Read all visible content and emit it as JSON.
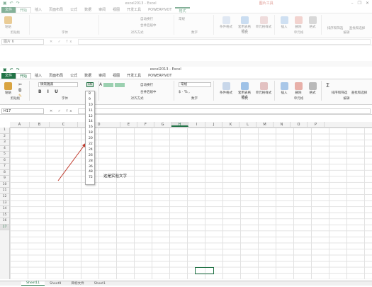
{
  "back_window": {
    "title": "excel2013 - Excel",
    "context_label": "图片工具",
    "tabs": [
      "文件",
      "开始",
      "插入",
      "页面布局",
      "公式",
      "数据",
      "审阅",
      "视图",
      "开发工具",
      "POWERPIVOT",
      "格式"
    ],
    "name_box": "图片 6",
    "groups": [
      "剪贴板",
      "字体",
      "对齐方式",
      "数字",
      "样式",
      "单元格",
      "编辑"
    ],
    "buttons": [
      "粘贴",
      "自动换行",
      "合并后居中",
      "常规",
      "条件格式",
      "套用表格格式",
      "单元格样式",
      "插入",
      "删除",
      "格式",
      "排序和筛选",
      "查找和选择"
    ]
  },
  "window": {
    "title": "excel2013 - Excel",
    "tabs": [
      "文件",
      "开始",
      "插入",
      "页面布局",
      "公式",
      "数据",
      "审阅",
      "视图",
      "开发工具",
      "POWERPIVOT"
    ],
    "font_name": "微软雅黑",
    "font_size": "16",
    "name_box": "H17",
    "groups": [
      "剪贴板",
      "字体",
      "对齐方式",
      "数字",
      "样式",
      "单元格",
      "编辑"
    ],
    "buttons": {
      "paste": "粘贴",
      "wrap": "自动换行",
      "merge": "合并后居中",
      "number_format": "常规",
      "cond_format": "条件格式",
      "table_format": "套用表格格式",
      "cell_style": "单元格样式",
      "insert": "插入",
      "delete": "删除",
      "format": "格式",
      "sort": "排序和筛选",
      "find": "查找和选择"
    }
  },
  "columns": [
    "A",
    "B",
    "C",
    "D",
    "E",
    "F",
    "G",
    "H",
    "I",
    "J",
    "K",
    "L",
    "M",
    "N",
    "O",
    "P"
  ],
  "selected_column": "H",
  "rows": [
    "1",
    "2",
    "3",
    "4",
    "5",
    "6",
    "7",
    "8",
    "9",
    "10",
    "11",
    "12",
    "13",
    "14",
    "15",
    "16",
    "17"
  ],
  "selected_row": "17",
  "font_sizes": [
    "8",
    "9",
    "10",
    "11",
    "12",
    "14",
    "16",
    "18",
    "20",
    "22",
    "24",
    "26",
    "28",
    "36",
    "48",
    "72"
  ],
  "cell_text": "这是实验文字",
  "sheet_tabs": [
    "Sheet11",
    "Sheet9",
    "目标文件",
    "Sheet1"
  ],
  "colors": {
    "accent": "#217346",
    "arrow": "#c0392b"
  }
}
